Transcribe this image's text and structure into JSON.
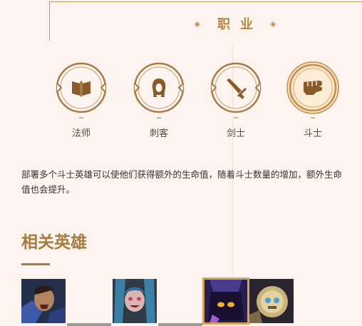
{
  "section": {
    "title": "职业"
  },
  "roles": [
    {
      "name": "法师",
      "marker": "–",
      "icon": "book-icon",
      "active": false
    },
    {
      "name": "刺客",
      "marker": "–",
      "icon": "hooded-assassin-icon",
      "active": false
    },
    {
      "name": "剑士",
      "marker": "–",
      "icon": "sword-icon",
      "active": false
    },
    {
      "name": "斗士",
      "marker": "–",
      "icon": "fist-icon",
      "active": true
    }
  ],
  "description": "部署多个斗士英雄可以使他们获得额外的生命值，随着斗士数量的增加，额外生命值也会提升。",
  "related_heroes": {
    "title": "相关英雄",
    "heroes": [
      {
        "portrait": "garen-portrait",
        "selected": false
      },
      {
        "portrait": "jinx-portrait",
        "selected": false
      },
      {
        "portrait": "veigar-portrait",
        "selected": true
      },
      {
        "portrait": "blitzcrank-portrait",
        "selected": false
      }
    ]
  },
  "colors": {
    "accent": "#b98642",
    "background": "#fdf3ef",
    "active_badge": "#fbe3c4"
  }
}
